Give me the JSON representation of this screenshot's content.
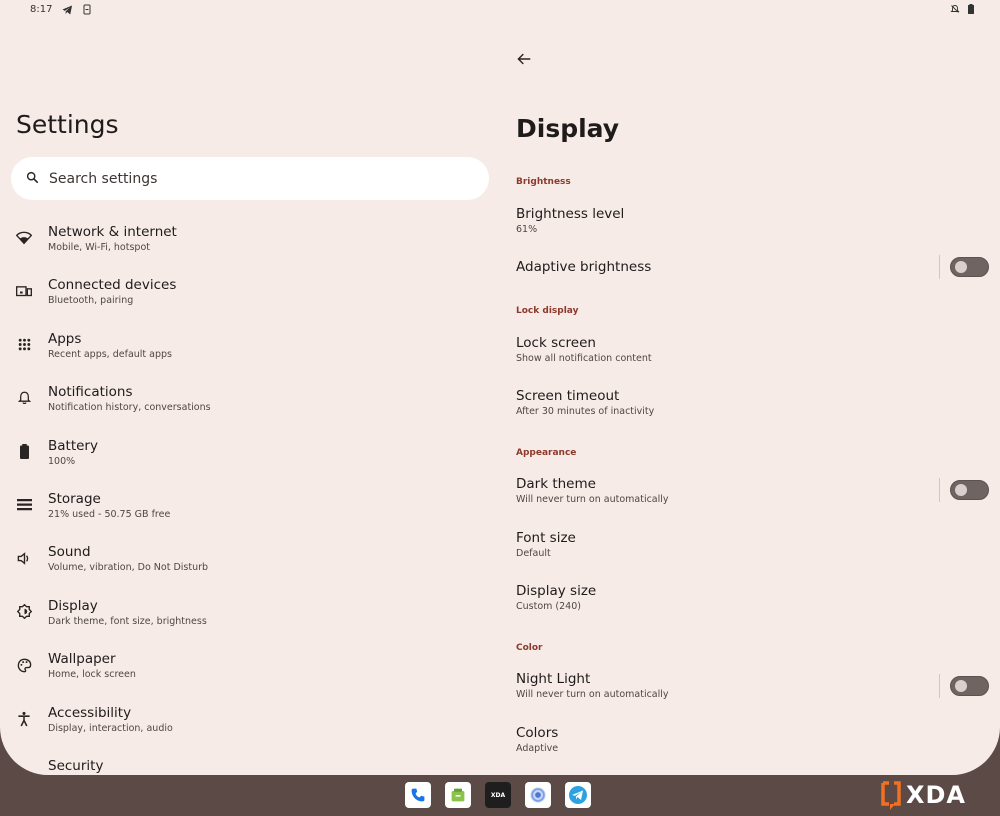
{
  "status_bar": {
    "time": "8:17"
  },
  "settings": {
    "title": "Settings",
    "search": {
      "placeholder": "Search settings"
    },
    "items": [
      {
        "title": "Network & internet",
        "subtitle": "Mobile, Wi-Fi, hotspot",
        "icon": "wifi-icon"
      },
      {
        "title": "Connected devices",
        "subtitle": "Bluetooth, pairing",
        "icon": "devices-icon"
      },
      {
        "title": "Apps",
        "subtitle": "Recent apps, default apps",
        "icon": "apps-grid-icon"
      },
      {
        "title": "Notifications",
        "subtitle": "Notification history, conversations",
        "icon": "bell-icon"
      },
      {
        "title": "Battery",
        "subtitle": "100%",
        "icon": "battery-icon"
      },
      {
        "title": "Storage",
        "subtitle": "21% used - 50.75 GB free",
        "icon": "storage-icon"
      },
      {
        "title": "Sound",
        "subtitle": "Volume, vibration, Do Not Disturb",
        "icon": "volume-icon"
      },
      {
        "title": "Display",
        "subtitle": "Dark theme, font size, brightness",
        "icon": "brightness-icon"
      },
      {
        "title": "Wallpaper",
        "subtitle": "Home, lock screen",
        "icon": "palette-icon"
      },
      {
        "title": "Accessibility",
        "subtitle": "Display, interaction, audio",
        "icon": "accessibility-icon"
      },
      {
        "title": "Security",
        "subtitle": "",
        "icon": ""
      }
    ]
  },
  "display": {
    "title": "Display",
    "sections": {
      "brightness": "Brightness",
      "lock_display": "Lock display",
      "appearance": "Appearance",
      "color": "Color"
    },
    "prefs": {
      "brightness_level": {
        "title": "Brightness level",
        "subtitle": "61%"
      },
      "adaptive_brightness": {
        "title": "Adaptive brightness",
        "enabled": false
      },
      "lock_screen": {
        "title": "Lock screen",
        "subtitle": "Show all notification content"
      },
      "screen_timeout": {
        "title": "Screen timeout",
        "subtitle": "After 30 minutes of inactivity"
      },
      "dark_theme": {
        "title": "Dark theme",
        "subtitle": "Will never turn on automatically",
        "enabled": false
      },
      "font_size": {
        "title": "Font size",
        "subtitle": "Default"
      },
      "display_size": {
        "title": "Display size",
        "subtitle": "Custom (240)"
      },
      "night_light": {
        "title": "Night Light",
        "subtitle": "Will never turn on automatically",
        "enabled": false
      },
      "colors": {
        "title": "Colors",
        "subtitle": "Adaptive"
      }
    }
  },
  "taskbar": {
    "apps": [
      "phone-app-icon",
      "store-app-icon",
      "xda-app-icon",
      "chrome-app-icon",
      "telegram-app-icon"
    ],
    "xda_label": "XDA"
  },
  "colors": {
    "background": "#f7ebe8",
    "accent": "#8c3a2b",
    "toggle_off": "#6f6462"
  },
  "watermark": {
    "text": "XDA"
  }
}
